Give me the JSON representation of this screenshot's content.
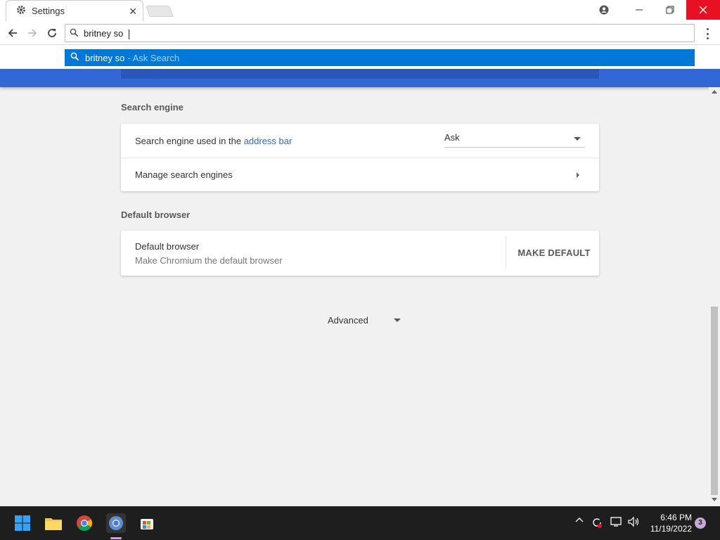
{
  "browser": {
    "tab": {
      "title": "Settings",
      "icon": "gear-icon"
    },
    "omnibox": {
      "value": "britney so"
    },
    "suggestion": {
      "query": "britney so",
      "provider": "- Ask Search"
    }
  },
  "settings": {
    "search_engine": {
      "section_title": "Search engine",
      "row_label_prefix": "Search engine used in the",
      "row_label_link": "address bar",
      "selected_engine": "Ask",
      "manage_label": "Manage search engines"
    },
    "default_browser": {
      "section_title": "Default browser",
      "title": "Default browser",
      "subtitle": "Make Chromium the default browser",
      "button_label": "MAKE DEFAULT"
    },
    "advanced_label": "Advanced"
  },
  "taskbar": {
    "time": "6:46 PM",
    "date": "11/19/2022",
    "notification_count": "3"
  },
  "colors": {
    "accent": "#3367d6",
    "suggestion_highlight": "#0078d7",
    "close_button": "#e81123"
  }
}
